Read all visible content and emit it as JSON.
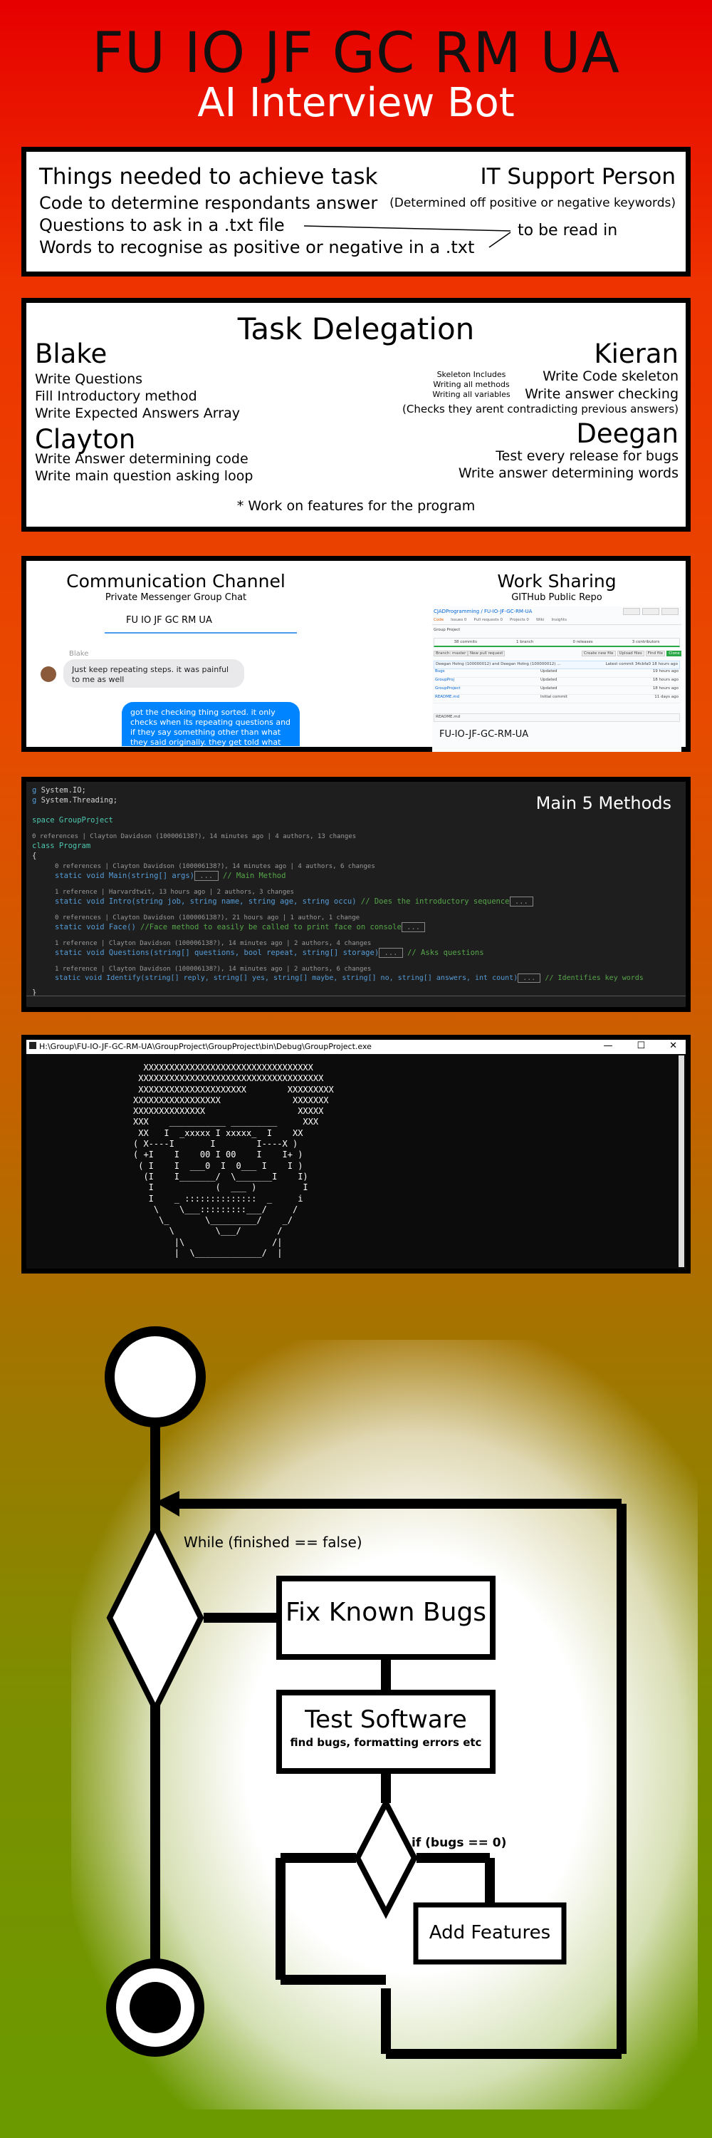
{
  "header": {
    "title": "FU IO JF GC RM UA",
    "subtitle": "AI Interview Bot"
  },
  "requirements": {
    "heading": "Things needed to achieve task",
    "items": [
      "Code to determine respondants answer",
      "Questions to ask in a .txt file",
      "Words to recognise as positive or negative in a .txt"
    ],
    "note": "to be read in",
    "role_title": "IT Support Person",
    "role_note": "(Determined off positive or negative keywords)"
  },
  "delegation": {
    "title": "Task Delegation",
    "blake": {
      "name": "Blake",
      "tasks": [
        "Write Questions",
        "Fill Introductory method",
        "Write Expected Answers Array"
      ]
    },
    "clayton": {
      "name": "Clayton",
      "tasks": [
        "Write Answer determining code",
        "Write main question asking loop"
      ]
    },
    "kieran": {
      "name": "Kieran",
      "tasks": [
        "Write Code skeleton",
        "Write answer checking",
        "(Checks they arent contradicting previous answers)"
      ],
      "skeleton_note": [
        "Skeleton Includes",
        "Writing all methods",
        "Writing all variables"
      ]
    },
    "deegan": {
      "name": "Deegan",
      "tasks": [
        "Test every release for bugs",
        "Write answer determining words"
      ]
    },
    "footnote": "* Work on features for the program"
  },
  "communication": {
    "title": "Communication Channel",
    "subtitle": "Private Messenger Group Chat",
    "chat_name": "FU IO JF GC RM UA",
    "sender": "Blake",
    "message_in": "Just keep repeating steps. it was painful to me as well",
    "message_out": "got the checking thing sorted. it only checks when its repeating questions and if they say something other than what they said originally. they get told what they said"
  },
  "work_sharing": {
    "title": "Work Sharing",
    "subtitle": "GITHub Public Repo",
    "repo_path": "CJADProgramming / FU-IO-JF-GC-RM-UA",
    "tabs": [
      "Code",
      "Issues 0",
      "Pull requests 0",
      "Projects 0",
      "Wiki",
      "Insights"
    ],
    "repo_desc": "Group Project",
    "stats": [
      "38 commits",
      "1 branch",
      "0 releases",
      "3 contributors"
    ],
    "branch_btn": "Branch: master",
    "new_pr_btn": "New pull request",
    "file_btns": [
      "Create new file",
      "Upload files",
      "Find file"
    ],
    "clone_btn": "Clone or download",
    "commit_msg": "Deegan Hotng (100000012) and Deegan Hotng (100000012) ...",
    "latest_commit": "Latest commit 34cbfa0 18 hours ago",
    "files": [
      {
        "name": "Bugs",
        "msg": "Updated",
        "age": "19 hours ago"
      },
      {
        "name": "GroupProj",
        "msg": "Updated",
        "age": "18 hours ago"
      },
      {
        "name": "GroupProject",
        "msg": "Updated",
        "age": "18 hours ago"
      },
      {
        "name": "README.md",
        "msg": "Initial commit",
        "age": "11 days ago"
      }
    ],
    "readme_label": "README.md",
    "readme_title": "FU-IO-JF-GC-RM-UA"
  },
  "code": {
    "title": "Main 5 Methods",
    "usings": [
      "System.IO;",
      "System.Threading;"
    ],
    "namespace_line": "space GroupProject",
    "class_meta": "0 references | Clayton Davidson (100006138?), 14 minutes ago | 4 authors, 13 changes",
    "class_line": "class Program",
    "methods": [
      {
        "meta": "0 references | Clayton Davidson (100006138?), 14 minutes ago | 4 authors, 6 changes",
        "sig": "static void Main(string[] args)",
        "comment": "// Main Method"
      },
      {
        "meta": "1 reference | Harvardtwit, 13 hours ago | 2 authors, 3 changes",
        "sig": "static void Intro(string job, string name, string age, string occu)",
        "comment": "// Does the introductory sequence"
      },
      {
        "meta": "0 references | Clayton Davidson (100006138?), 21 hours ago | 1 author, 1 change",
        "sig": "static void Face()",
        "comment": "//Face method to easily be called to print face on console"
      },
      {
        "meta": "1 reference | Clayton Davidson (100006138?), 14 minutes ago | 2 authors, 4 changes",
        "sig": "static void Questions(string[] questions, bool repeat, string[] storage)",
        "comment": "// Asks questions"
      },
      {
        "meta": "1 reference | Clayton Davidson (100006138?), 14 minutes ago | 2 authors, 6 changes",
        "sig": "static void Identify(string[] reply, string[] yes, string[] maybe, string[] no, string[] answers, int count)",
        "comment": "// Identifies key words"
      }
    ]
  },
  "console": {
    "path": "H:\\Group\\FU-IO-JF-GC-RM-UA\\GroupProject\\GroupProject\\bin\\Debug\\GroupProject.exe",
    "controls": [
      "—",
      "☐",
      "✕"
    ],
    "ascii_face": "  XXXXXXXXXXXXXXXXXXXXXXXXXXXXXXXXX\n XXXXXXXXXXXXXXXXXXXXXXXXXXXXXXXXXXXX\n XXXXXXXXXXXXXXXXXXXXX        XXXXXXXXX\nXXXXXXXXXXXXXXXXX              XXXXXXX\nXXXXXXXXXXXXXX                  XXXXX\nXXX    ___________ _________     XXX\n XX   I  _xxxxx I xxxxx_  I    XX\n( X----I       I        I----X )\n( +I    I    00 I 00    I    I+ )\n ( I    I  ___0  I  0___ I    I )\n  (I    I_______/  \\_______I    I)\n   I            (  ___ )         I\n   I    _ ::::::::::::::  _     i\n    \\    \\___:::::::::___/     /\n     \\_       \\_________/    _/\n       \\        \\___/       /\n        |\\                 /|\n        |  \\_____________/  |"
  },
  "flowchart": {
    "loop_label": "While (finished == false)",
    "fix_label": "Fix Known Bugs",
    "test_label": "Test Software",
    "test_sub": "find bugs, formatting errors etc",
    "bugs_label": "if (bugs == 0)",
    "add_label": "Add Features"
  }
}
